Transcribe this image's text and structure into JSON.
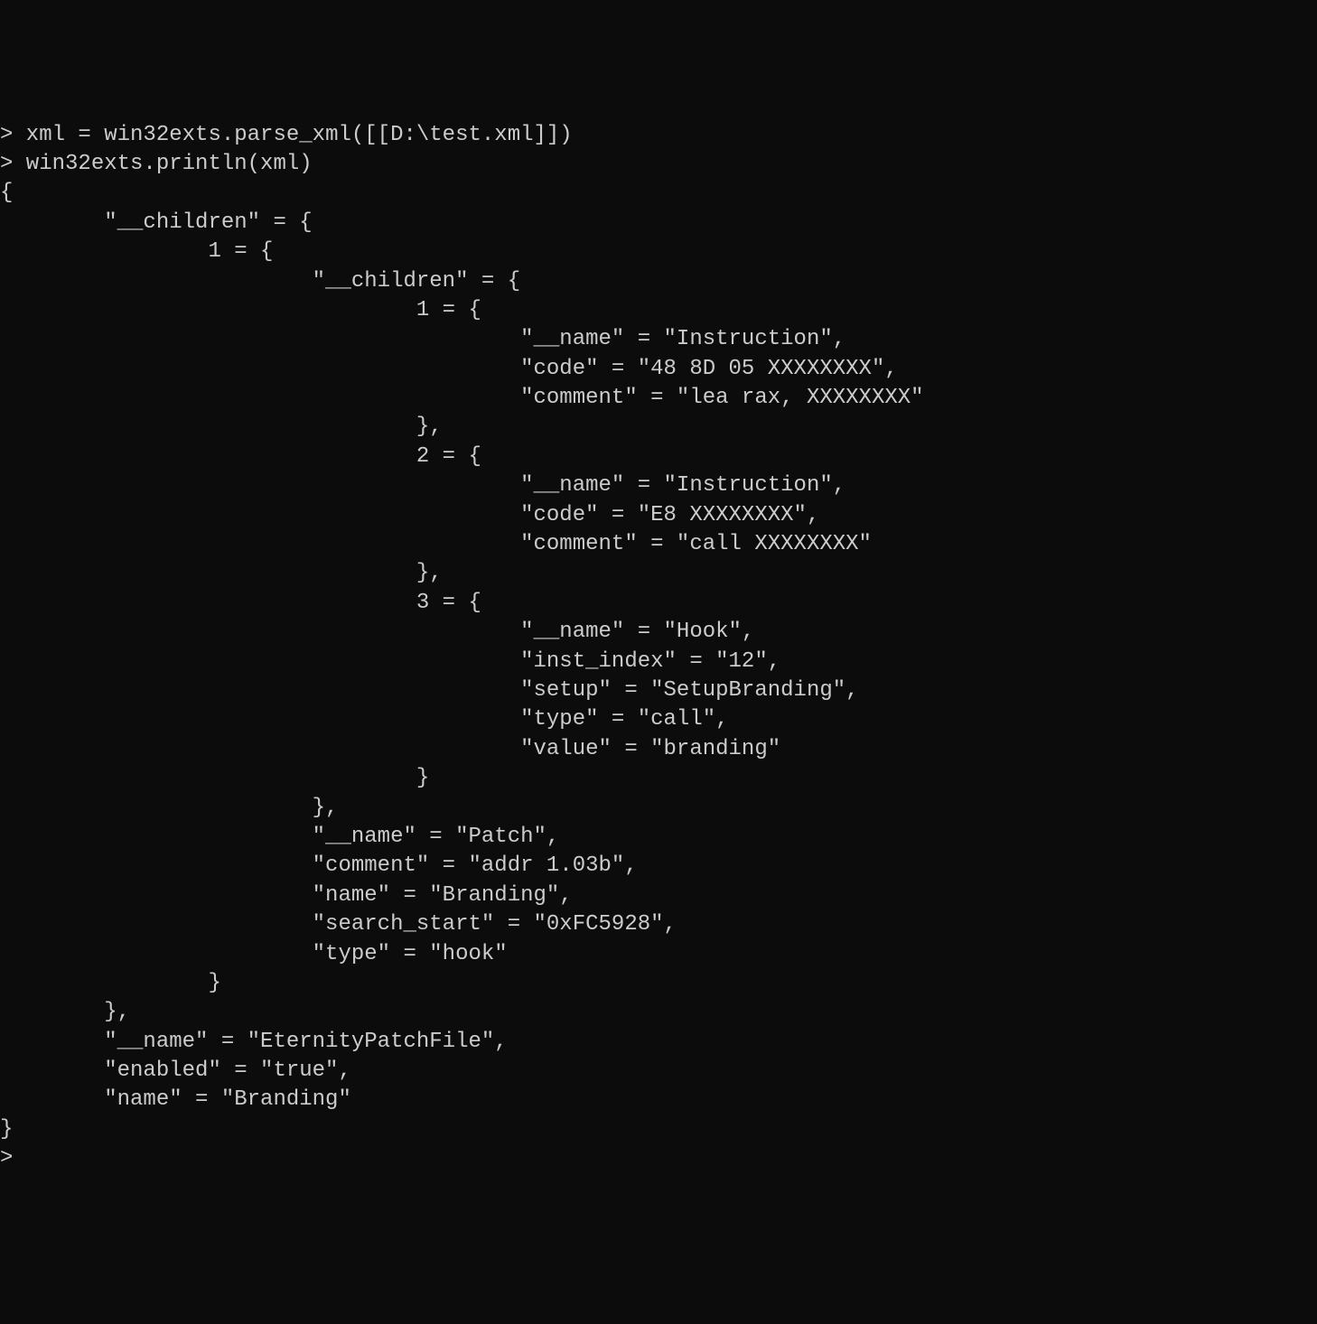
{
  "terminal": {
    "prompt_char": ">",
    "input_line_1": " xml = win32exts.parse_xml([[D:\\test.xml]])",
    "input_line_2": " win32exts.println(xml)",
    "output": {
      "brace_open": "{",
      "brace_close": "}",
      "comma_brace_close": "},",
      "children_key": "\"__children\" = {",
      "index_1": "1 = {",
      "index_2": "2 = {",
      "index_3": "3 = {",
      "brace_only": "}",
      "root": {
        "name_kv": "\"__name\" = \"EternityPatchFile\",",
        "enabled_kv": "\"enabled\" = \"true\",",
        "name_attr_kv": "\"name\" = \"Branding\""
      },
      "patch": {
        "name_kv": "\"__name\" = \"Patch\",",
        "comment_kv": "\"comment\" = \"addr 1.03b\",",
        "name_attr_kv": "\"name\" = \"Branding\",",
        "search_start_kv": "\"search_start\" = \"0xFC5928\",",
        "type_kv": "\"type\" = \"hook\""
      },
      "instr_1": {
        "name_kv": "\"__name\" = \"Instruction\",",
        "code_kv": "\"code\" = \"48 8D 05 XXXXXXXX\",",
        "comment_kv": "\"comment\" = \"lea rax, XXXXXXXX\""
      },
      "instr_2": {
        "name_kv": "\"__name\" = \"Instruction\",",
        "code_kv": "\"code\" = \"E8 XXXXXXXX\",",
        "comment_kv": "\"comment\" = \"call XXXXXXXX\""
      },
      "hook": {
        "name_kv": "\"__name\" = \"Hook\",",
        "inst_index_kv": "\"inst_index\" = \"12\",",
        "setup_kv": "\"setup\" = \"SetupBranding\",",
        "type_kv": "\"type\" = \"call\",",
        "value_kv": "\"value\" = \"branding\""
      }
    },
    "indent": {
      "i0": "",
      "i8": "        ",
      "i16": "                ",
      "i24": "                        ",
      "i32": "                                ",
      "i40": "                                        ",
      "i48": "                                                "
    }
  }
}
